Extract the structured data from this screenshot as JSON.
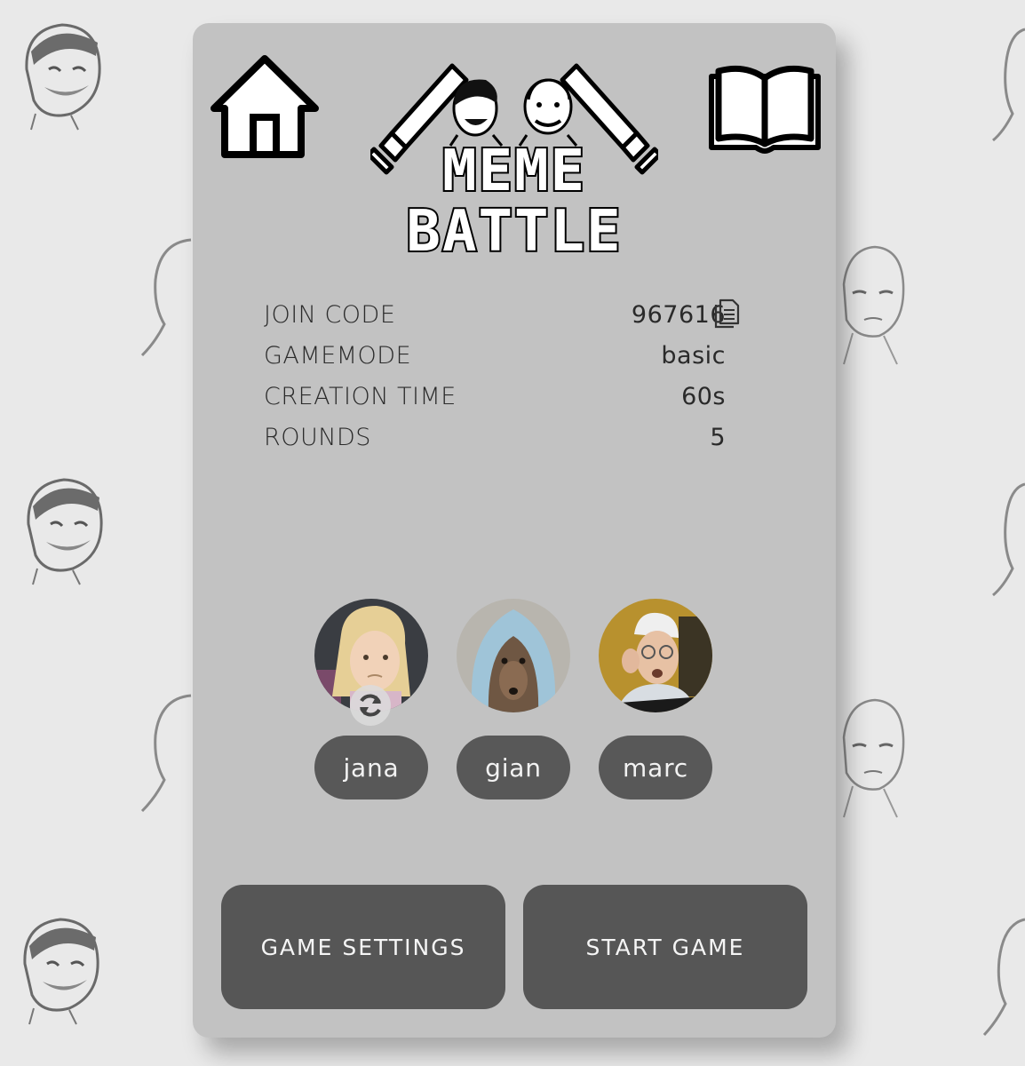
{
  "app": {
    "logo_line1": "MEME",
    "logo_line2": "BATTLE"
  },
  "nav": {
    "home_icon": "home-icon",
    "rules_icon": "open-book-icon"
  },
  "lobby": {
    "join_code_label": "JOIN CODE",
    "join_code_value": "967616",
    "copy_icon": "copy-document-icon",
    "gamemode_label": "GAMEMODE",
    "gamemode_value": "basic",
    "creation_time_label": "CREATION TIME",
    "creation_time_value": "60s",
    "rounds_label": "ROUNDS",
    "rounds_value": "5"
  },
  "players": [
    {
      "name": "jana",
      "avatar": "side-eye-girl-meme"
    },
    {
      "name": "gian",
      "avatar": "hoodie-chihuahua-meme"
    },
    {
      "name": "marc",
      "avatar": "grandma-computer-meme"
    }
  ],
  "actions": {
    "settings_label": "GAME SETTINGS",
    "start_label": "START GAME"
  },
  "colors": {
    "page_bg": "#e9e9e9",
    "card_bg": "#c2c2c2",
    "button_bg": "#565656",
    "pill_bg": "#585858"
  }
}
